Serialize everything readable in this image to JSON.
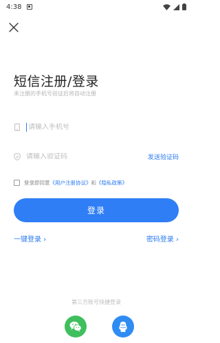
{
  "status_bar": {
    "time": "4:38"
  },
  "header": {
    "title": "短信注册/登录",
    "subtitle": "未注册的手机号验证后将自动注册"
  },
  "form": {
    "phone_placeholder": "请输入手机号",
    "code_placeholder": "请输入验证码",
    "send_code_label": "发送验证码",
    "agreement": {
      "prefix": "登录即同意",
      "user_agreement": "《用户注册协议》",
      "and": "和",
      "privacy_policy": "《隐私政策》"
    },
    "login_button": "登录",
    "quick_login": "一键登录 ›",
    "password_login": "密码登录 ›"
  },
  "third_party": {
    "title": "第三方账号快捷登录",
    "providers": [
      "wechat-icon",
      "qq-icon"
    ]
  },
  "colors": {
    "accent": "#2f7ef6",
    "wechat": "#3fbf5e",
    "qq": "#2f8cf3"
  }
}
